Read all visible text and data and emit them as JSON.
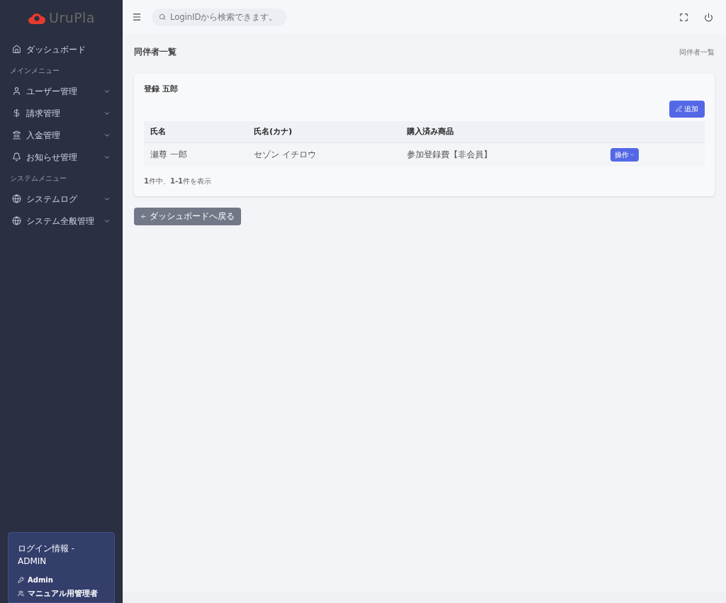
{
  "logo": {
    "text": "UruPla"
  },
  "sidebar": {
    "items": [
      {
        "kind": "link",
        "label": "ダッシュボード",
        "expandable": false
      },
      {
        "kind": "heading",
        "label": "メインメニュー"
      },
      {
        "kind": "link",
        "label": "ユーザー管理",
        "expandable": true
      },
      {
        "kind": "link",
        "label": "請求管理",
        "expandable": true
      },
      {
        "kind": "link",
        "label": "入金管理",
        "expandable": true
      },
      {
        "kind": "link",
        "label": "お知らせ管理",
        "expandable": true
      },
      {
        "kind": "heading",
        "label": "システムメニュー"
      },
      {
        "kind": "link",
        "label": "システムログ",
        "expandable": true
      },
      {
        "kind": "link",
        "label": "システム全般管理",
        "expandable": true
      }
    ]
  },
  "login_info": {
    "title": "ログイン情報 - ADMIN",
    "user": "Admin",
    "role": "マニュアル用管理者"
  },
  "search": {
    "placeholder": "LoginIDから検索できます。"
  },
  "page": {
    "title": "同伴者一覧",
    "breadcrumb": "同伴者一覧"
  },
  "card": {
    "title": "登録 五郎",
    "add_button": "追加",
    "table": {
      "columns": [
        "氏名",
        "氏名(カナ)",
        "購入済み商品"
      ],
      "rows": [
        {
          "cells": [
            "瀬尊 一郎",
            "セゾン イチロウ",
            "参加登録費【非会員】"
          ],
          "action": "操作"
        }
      ]
    },
    "summary": "**1**件中、**1-1**件を表示"
  },
  "back_button": "ダッシュボードへ戻る"
}
